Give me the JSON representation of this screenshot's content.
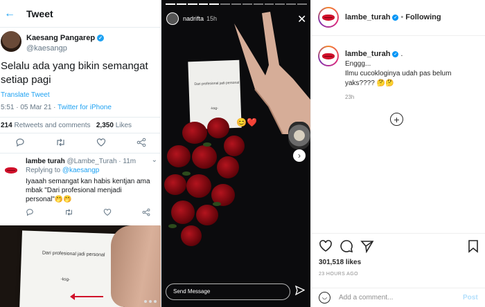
{
  "twitter": {
    "header_title": "Tweet",
    "author_name": "Kaesang Pangarep",
    "author_handle": "@kaesangp",
    "tweet_text": "Selalu ada yang bikin semangat setiap pagi",
    "translate_label": "Translate Tweet",
    "timestamp": "5:51 · 05 Mar 21 ·",
    "source": "Twitter for iPhone",
    "retweets_count": "214",
    "retweets_label": "Retweets and comments",
    "likes_count": "2,350",
    "likes_label": "Likes",
    "reply": {
      "name": "lambe turah",
      "handle_time": "@Lambe_Turah · 11m",
      "replying_label": "Replying to",
      "replying_handle": "@kaesangp",
      "text": "Iyaaah semangat kan habis kentjan ama mbak \"Dari profesional menjadi personal\"🤭🤭"
    },
    "photo": {
      "paper_text": "Dari profesional jadi personal",
      "paper_sig": "-ksg-"
    }
  },
  "story": {
    "username": "nadrifta",
    "time": "15h",
    "paper_text": "Dari profesional jadi personal",
    "paper_sig": "-ksg-",
    "emoji": "😊❤️",
    "message_placeholder": "Send Message"
  },
  "instagram": {
    "username": "lambe_turah",
    "follow_label": "Following",
    "caption_username": "lambe_turah",
    "caption_line1": "Enggg...",
    "caption_line2": "Ilmu cucokloginya udah pas belum yaks???? 🤔🤔",
    "caption_time": "23h",
    "likes": "301,518 likes",
    "posted_ago": "23 HOURS AGO",
    "comment_placeholder": "Add a comment...",
    "post_label": "Post"
  },
  "colors": {
    "twitter_blue": "#1da1f2",
    "instagram_blue": "#0095f6",
    "rose_red": "#b3141e"
  }
}
